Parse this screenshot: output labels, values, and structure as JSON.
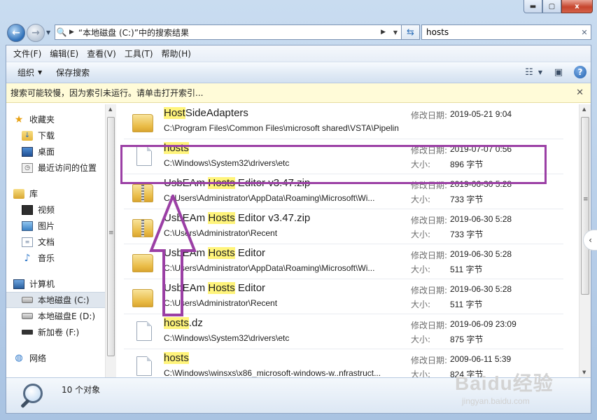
{
  "window": {
    "controls": {
      "minimize": "▬",
      "maximize": "▢",
      "close": "x"
    }
  },
  "nav": {
    "back_icon": "back-arrow-icon",
    "forward_icon": "forward-arrow-icon",
    "address_path": "“本地磁盘 (C:)”中的搜索结果",
    "search_value": "hosts"
  },
  "menu": [
    "文件(F)",
    "编辑(E)",
    "查看(V)",
    "工具(T)",
    "帮助(H)"
  ],
  "commands": {
    "organize": "组织",
    "save_search": "保存搜索"
  },
  "infobar": "搜索可能较慢，因为索引未运行。请单击打开索引...",
  "sidebar": {
    "favorites": {
      "label": "收藏夹",
      "items": [
        "下载",
        "桌面",
        "最近访问的位置"
      ]
    },
    "libraries": {
      "label": "库",
      "items": [
        "视频",
        "图片",
        "文档",
        "音乐"
      ]
    },
    "computer": {
      "label": "计算机",
      "items": [
        "本地磁盘 (C:)",
        "本地磁盘E (D:)",
        "新加卷 (F:)"
      ]
    },
    "network": {
      "label": "网络"
    }
  },
  "results": [
    {
      "type": "folder",
      "name_hl": "Host",
      "name_rest": "SideAdapters",
      "name_pre": "",
      "path": "C:\\Program Files\\Common Files\\microsoft shared\\VSTA\\Pipeline",
      "label1": "修改日期:",
      "value1": "2019-05-21 9:04",
      "label2": "",
      "value2": ""
    },
    {
      "type": "file",
      "name_pre": "",
      "name_hl": "hosts",
      "name_rest": "",
      "path": "C:\\Windows\\System32\\drivers\\etc",
      "label1": "修改日期:",
      "value1": "2019-07-07 0:56",
      "label2": "大小:",
      "value2": "896 字节"
    },
    {
      "type": "zip",
      "name_pre": "UsbEAm ",
      "name_hl": "Hosts",
      "name_rest": " Editor v3.47.zip",
      "path": "C:\\Users\\Administrator\\AppData\\Roaming\\Microsoft\\Wi...",
      "label1": "修改日期:",
      "value1": "2019-06-30 5:28",
      "label2": "大小:",
      "value2": "733 字节"
    },
    {
      "type": "zip",
      "name_pre": "UsbEAm ",
      "name_hl": "Hosts",
      "name_rest": " Editor v3.47.zip",
      "path": "C:\\Users\\Administrator\\Recent",
      "label1": "修改日期:",
      "value1": "2019-06-30 5:28",
      "label2": "大小:",
      "value2": "733 字节"
    },
    {
      "type": "folder",
      "name_pre": "UsbEAm ",
      "name_hl": "Hosts",
      "name_rest": " Editor",
      "path": "C:\\Users\\Administrator\\AppData\\Roaming\\Microsoft\\Wi...",
      "label1": "修改日期:",
      "value1": "2019-06-30 5:28",
      "label2": "大小:",
      "value2": "511 字节"
    },
    {
      "type": "folder",
      "name_pre": "UsbEAm ",
      "name_hl": "Hosts",
      "name_rest": " Editor",
      "path": "C:\\Users\\Administrator\\Recent",
      "label1": "修改日期:",
      "value1": "2019-06-30 5:28",
      "label2": "大小:",
      "value2": "511 字节"
    },
    {
      "type": "file",
      "name_pre": "",
      "name_hl": "hosts",
      "name_rest": ".dz",
      "path": "C:\\Windows\\System32\\drivers\\etc",
      "label1": "修改日期:",
      "value1": "2019-06-09 23:09",
      "label2": "大小:",
      "value2": "875 字节"
    },
    {
      "type": "file",
      "name_pre": "",
      "name_hl": "hosts",
      "name_rest": "",
      "path": "C:\\Windows\\winsxs\\x86_microsoft-windows-w..nfrastruct...",
      "label1": "修改日期:",
      "value1": "2009-06-11 5:39",
      "label2": "大小:",
      "value2": "824 字节"
    }
  ],
  "status": {
    "count": "10 个对象"
  },
  "watermark": {
    "main": "Baidu经验",
    "sub": "jingyan.baidu.com"
  },
  "colors": {
    "annotation": "#9b3fa5",
    "highlight": "#fff47b",
    "infobar_bg": "#fffbd8"
  }
}
